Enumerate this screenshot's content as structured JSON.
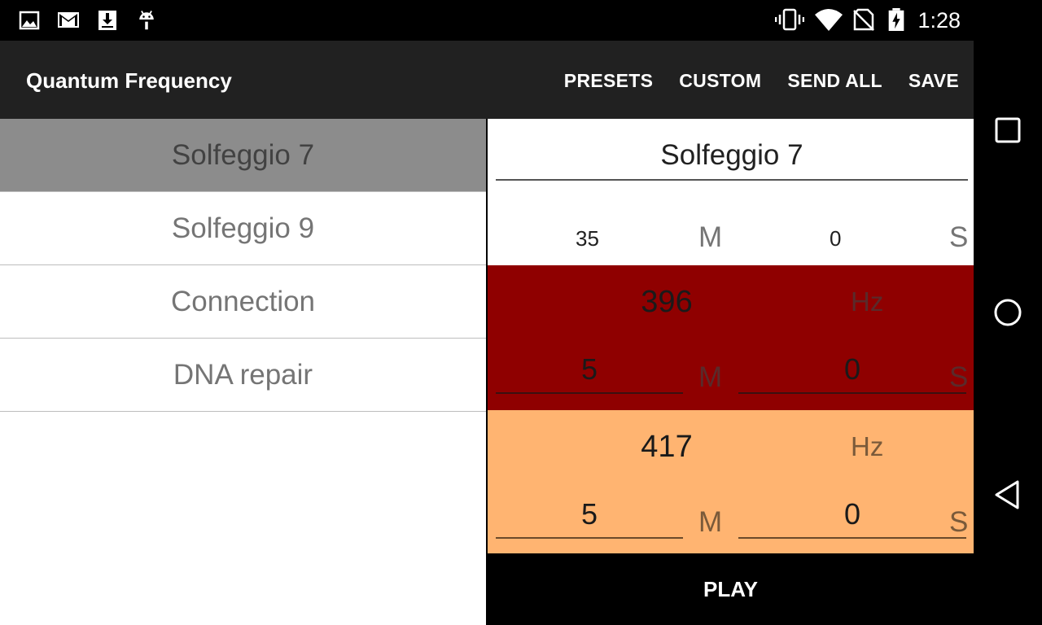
{
  "status_bar": {
    "icons": [
      "image-icon",
      "gmail-icon",
      "download-icon",
      "android-icon"
    ],
    "right_icons": [
      "vibrate-icon",
      "wifi-icon",
      "no-sim-icon",
      "battery-charging-icon"
    ],
    "time": "1:28"
  },
  "app_bar": {
    "title": "Quantum Frequency",
    "menu": [
      "PRESETS",
      "CUSTOM",
      "SEND ALL",
      "SAVE"
    ]
  },
  "presets": [
    {
      "label": "Solfeggio 7",
      "selected": true
    },
    {
      "label": "Solfeggio 9",
      "selected": false
    },
    {
      "label": "Connection",
      "selected": false
    },
    {
      "label": "DNA repair",
      "selected": false
    }
  ],
  "detail": {
    "name": "Solfeggio 7",
    "total": {
      "minutes": "35",
      "minutes_unit": "M",
      "seconds": "0",
      "seconds_unit": "S"
    },
    "frequencies": [
      {
        "value": "396",
        "unit": "Hz",
        "minutes": "5",
        "minutes_unit": "M",
        "seconds": "0",
        "seconds_unit": "S",
        "color": "#8f0000"
      },
      {
        "value": "417",
        "unit": "Hz",
        "minutes": "5",
        "minutes_unit": "M",
        "seconds": "0",
        "seconds_unit": "S",
        "color": "#ffb471"
      }
    ],
    "play_label": "PLAY"
  },
  "nav_bar": [
    "recents-icon",
    "home-icon",
    "back-icon"
  ]
}
